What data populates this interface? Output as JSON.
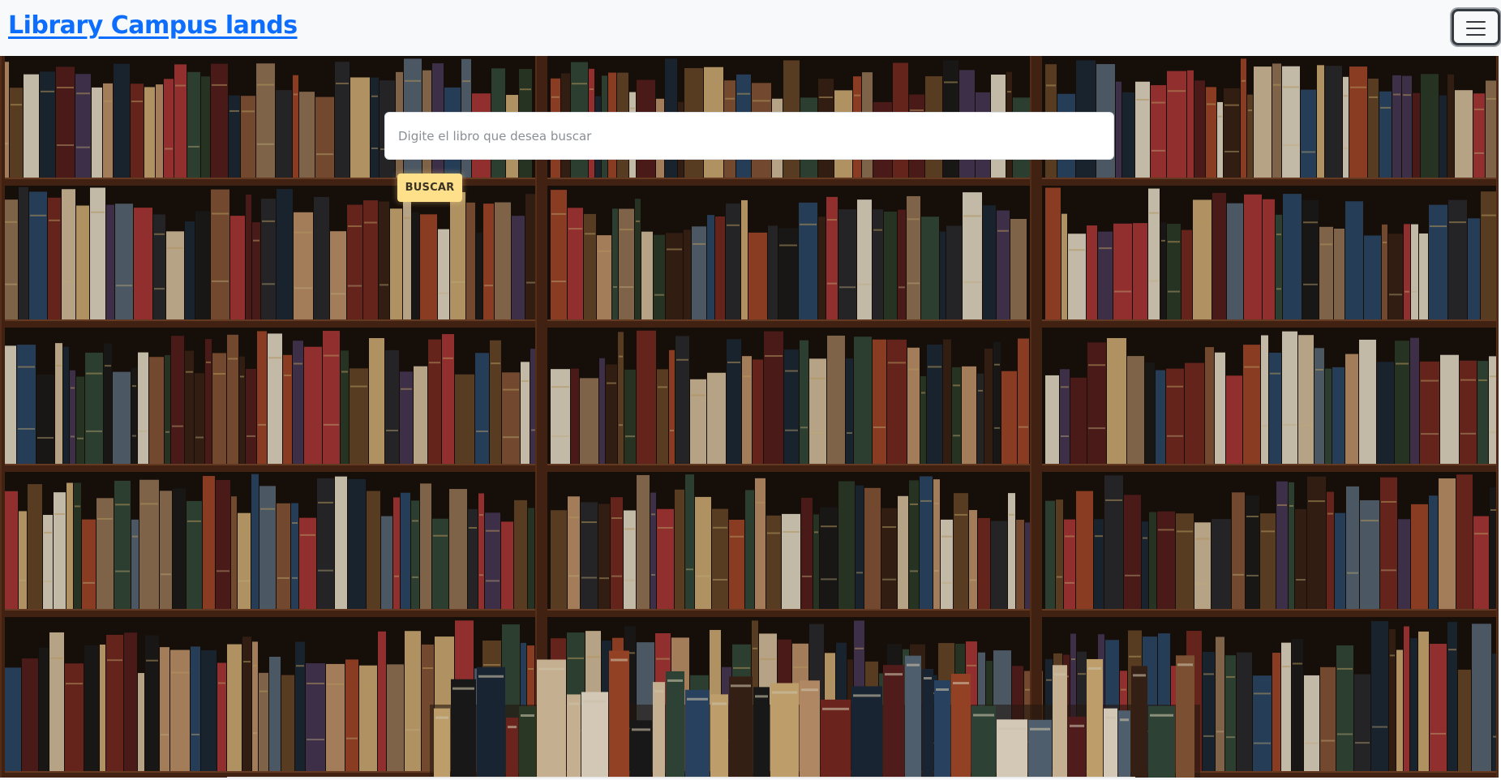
{
  "navbar": {
    "brand": "Library Campus lands",
    "toggler_icon": "hamburger-menu-icon"
  },
  "search": {
    "placeholder": "Digite el libro que desea buscar",
    "value": "",
    "button_label": "BUSCAR"
  },
  "colors": {
    "brand": "#0d6efd",
    "navbar_bg": "#f8f9fa",
    "button_bg": "#ffe08a",
    "shelf_wood": "#4a2615"
  }
}
